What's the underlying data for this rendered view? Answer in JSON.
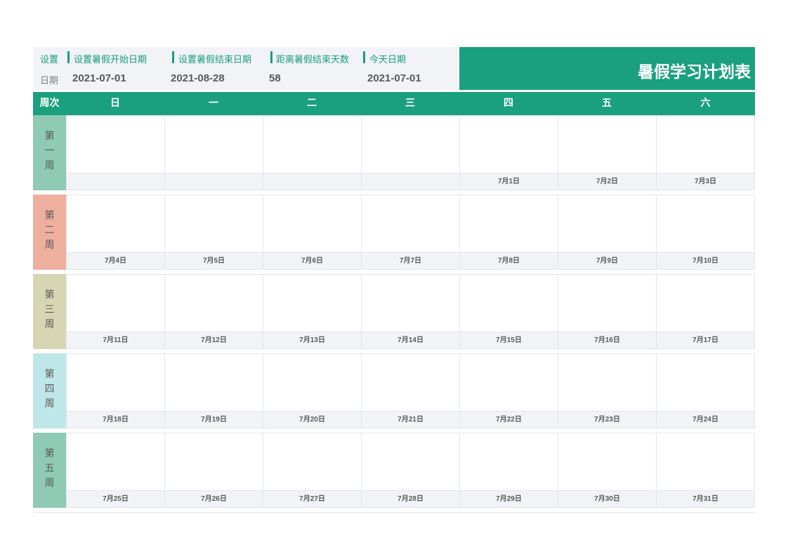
{
  "settings": {
    "row_label": "设置",
    "date_label": "日期",
    "start_label": "设置暑假开始日期",
    "end_label": "设置暑假结束日期",
    "remaining_label": "距离暑假结束天数",
    "today_label": "今天日期",
    "start_value": "2021-07-01",
    "end_value": "2021-08-28",
    "remaining_value": "58",
    "today_value": "2021-07-01"
  },
  "title": "暑假学习计划表",
  "header": {
    "week_col": "周次",
    "days": [
      "日",
      "一",
      "二",
      "三",
      "四",
      "五",
      "六"
    ]
  },
  "colors": {
    "accent": "#1aa07f",
    "week_colors": [
      "#8ecab4",
      "#eeaf9e",
      "#d6d6b4",
      "#bfe6e8",
      "#8ecab4"
    ]
  },
  "weeks": [
    {
      "label": [
        "第",
        "一",
        "周"
      ],
      "dates": [
        "",
        "",
        "",
        "",
        "7月1日",
        "7月2日",
        "7月3日"
      ]
    },
    {
      "label": [
        "第",
        "二",
        "周"
      ],
      "dates": [
        "7月4日",
        "7月5日",
        "7月6日",
        "7月7日",
        "7月8日",
        "7月9日",
        "7月10日"
      ]
    },
    {
      "label": [
        "第",
        "三",
        "周"
      ],
      "dates": [
        "7月11日",
        "7月12日",
        "7月13日",
        "7月14日",
        "7月15日",
        "7月16日",
        "7月17日"
      ]
    },
    {
      "label": [
        "第",
        "四",
        "周"
      ],
      "dates": [
        "7月18日",
        "7月19日",
        "7月20日",
        "7月21日",
        "7月22日",
        "7月23日",
        "7月24日"
      ]
    },
    {
      "label": [
        "第",
        "五",
        "周"
      ],
      "dates": [
        "7月25日",
        "7月26日",
        "7月27日",
        "7月28日",
        "7月29日",
        "7月30日",
        "7月31日"
      ]
    }
  ]
}
